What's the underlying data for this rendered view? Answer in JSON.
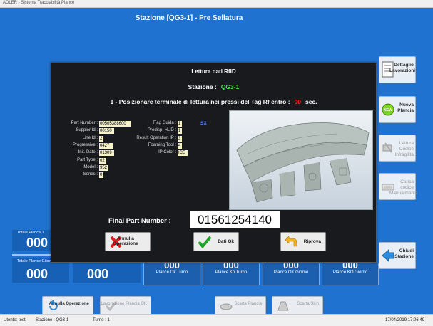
{
  "window": {
    "title": "ADLER - Sistema Tracciabilità Plance"
  },
  "screen": {
    "title": "Stazione [QG3-1] - Pre Sellatura"
  },
  "sidebar": [
    {
      "label": "Dettaglio Lavorazioni"
    },
    {
      "label": "Nuova Plancia"
    },
    {
      "label": "Lettura Codice Infragilita"
    },
    {
      "label": "Carica codice Manualmente"
    },
    {
      "label": "Chiudi Stazione"
    }
  ],
  "totals": {
    "turno_label": "Totale Plance T",
    "turno_value": "000",
    "giorno_label": "Totale Plance Giorno",
    "giorno_value": "000",
    "ko_giorno_label": "Totale Ko Plance Giorno",
    "ko_giorno_value": "000"
  },
  "plance": [
    {
      "value": "000",
      "label": "Plance Ok Turno"
    },
    {
      "value": "000",
      "label": "Plance Ko Turno"
    },
    {
      "value": "000",
      "label": "Plance OK Giorno"
    },
    {
      "value": "000",
      "label": "Plance KO Giorno"
    }
  ],
  "bottom_buttons": {
    "annulla": "Annulla Operazione",
    "lavorazione": "Lavorazione Plancia OK",
    "scarta_plancia": "Scarta Plancia",
    "scarta_skin": "Scarta Skin"
  },
  "status": {
    "user": "Utente:  test",
    "station": "Stazione :  QG3-1",
    "shift": "Turno :    1",
    "datetime": "17/04/2019 17:06:49"
  },
  "dialog": {
    "title": "Lettura dati RfID",
    "station_label": "Stazione :",
    "station_code": "QG3-1",
    "message": "1 - Posizionare terminale di lettura nei pressi del Tag Rf entro :",
    "seconds": "00",
    "seconds_unit": "sec.",
    "fields_left": [
      {
        "key": "Part Number :",
        "value": "00505388600"
      },
      {
        "key": "Suppier Id :",
        "value": "00150"
      },
      {
        "key": "Line Id :",
        "value": "2"
      },
      {
        "key": "Progressive :",
        "value": "0427"
      },
      {
        "key": "Init. Date :",
        "value": "01309"
      },
      {
        "key": "Part Type :",
        "value": "02"
      },
      {
        "key": "Model :",
        "value": "952"
      },
      {
        "key": "Series :",
        "value": "0"
      }
    ],
    "fields_right": [
      {
        "key": "Flag Guida :",
        "value": "1"
      },
      {
        "key": "Predisp. HUD :",
        "value": "1"
      },
      {
        "key": "Result Operation IP :",
        "value": "3"
      },
      {
        "key": "Foaming Tool :",
        "value": "4"
      },
      {
        "key": "IP Color :",
        "value": "ICE"
      }
    ],
    "side": "SX",
    "final_part_label": "Final Part Number :",
    "final_part_value": "01561254140",
    "buttons": {
      "annulla": "Annulla Operazione",
      "dati_ok": "Dati Ok",
      "riprova": "Riprova"
    }
  },
  "colors": {
    "background": "#1f72cf",
    "dialog": "#181a1d",
    "accent_green": "#49e24a",
    "countdown_red": "#ff2626",
    "field_bg": "#f5f3c7"
  }
}
